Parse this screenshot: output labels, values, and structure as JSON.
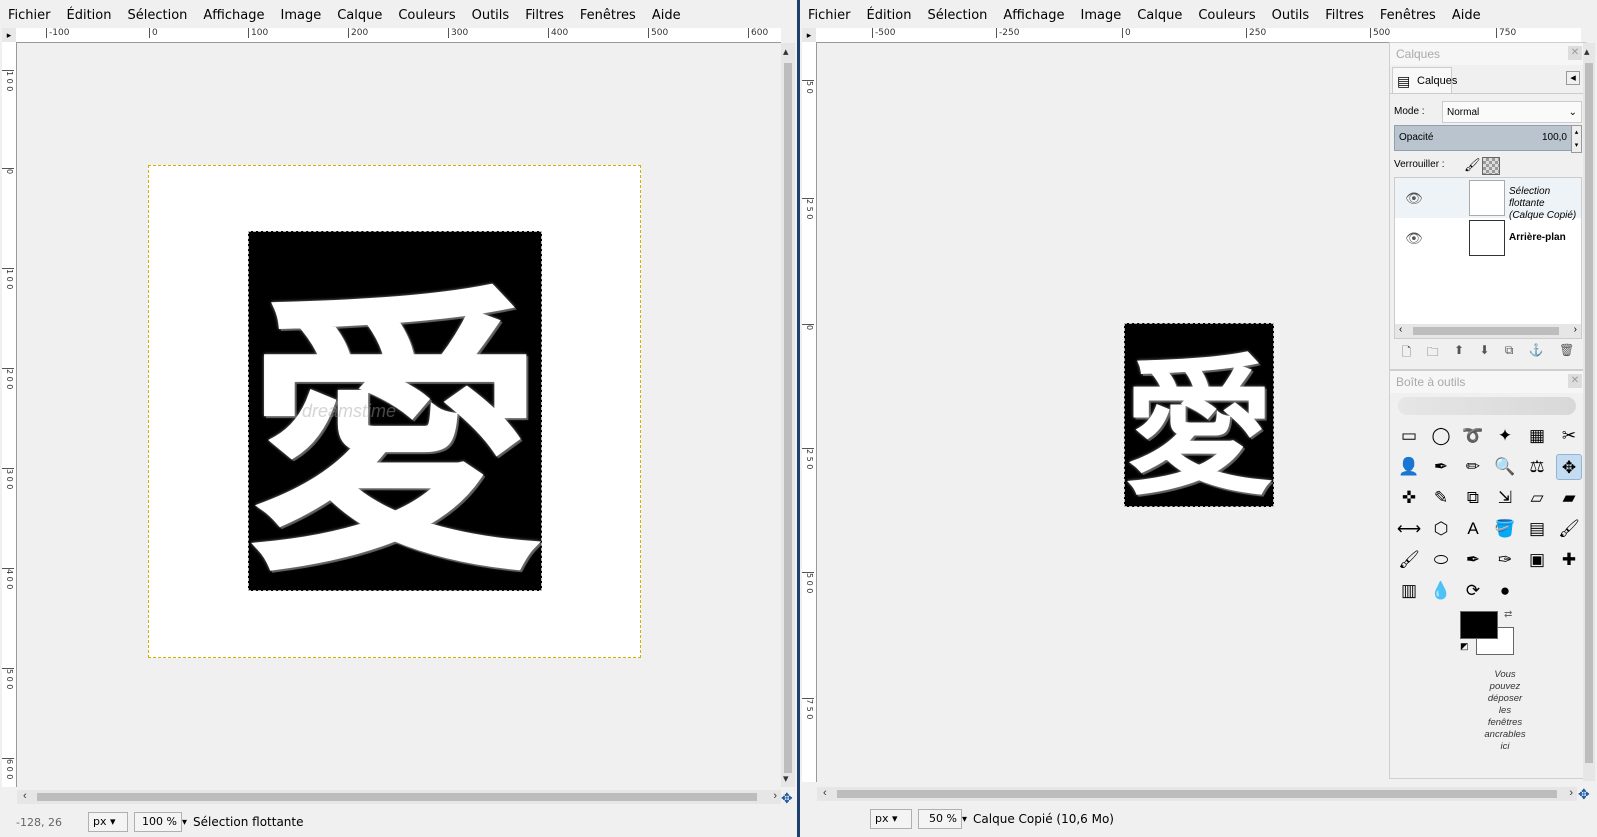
{
  "menu": [
    "Fichier",
    "Édition",
    "Sélection",
    "Affichage",
    "Image",
    "Calque",
    "Couleurs",
    "Outils",
    "Filtres",
    "Fenêtres",
    "Aide"
  ],
  "left": {
    "ruler_top": [
      "-100",
      "0",
      "100",
      "200",
      "300",
      "400",
      "500",
      "600"
    ],
    "ruler_left": [
      "1 0 0",
      "0",
      "1 0 0",
      "2 0 0",
      "3 0 0",
      "4 0 0",
      "5 0 0",
      "6 0 0"
    ],
    "kanji": "愛",
    "watermark": "dreamstime",
    "status": {
      "coords": "-128, 26",
      "unit": "px",
      "zoom": "100 %",
      "message": "Sélection flottante"
    }
  },
  "right": {
    "ruler_top": [
      "-500",
      "-250",
      "0",
      "250",
      "500",
      "750"
    ],
    "ruler_left": [
      "5 0",
      "2 5 0",
      "0",
      "2 5 0",
      "5 0 0",
      "7 5 0"
    ],
    "kanji": "愛",
    "status": {
      "unit": "px",
      "zoom": "50 %",
      "message": "Calque Copié (10,6 Mo)"
    }
  },
  "layers_panel": {
    "title": "Calques",
    "tab": "Calques",
    "mode_label": "Mode :",
    "mode_value": "Normal",
    "opacity_label": "Opacité",
    "opacity_value": "100,0",
    "lock_label": "Verrouiller :",
    "layers": [
      {
        "name": "Sélection flottante\n(Calque Copié)",
        "italic": true
      },
      {
        "name": "Arrière-plan",
        "italic": false
      }
    ]
  },
  "toolbox": {
    "title": "Boîte à outils",
    "hint": "Vous\npouvez\ndéposer\nles\nfenêtres\nancrables\nici",
    "tools": [
      "▭",
      "◯",
      "➰",
      "✦",
      "▦",
      "✂",
      "👤",
      "✒",
      "✏",
      "🔍",
      "⚖",
      "✥",
      "✜",
      "✎",
      "⧉",
      "⇲",
      "▱",
      "▰",
      "⟷",
      "⬡",
      "A",
      "🪣",
      "▤",
      "🖌",
      "🖌",
      "⬭",
      "✒",
      "✑",
      "▣",
      "✚",
      "▥",
      "💧",
      "⟳",
      "●"
    ],
    "fg_color": "#000000",
    "bg_color": "#ffffff"
  }
}
